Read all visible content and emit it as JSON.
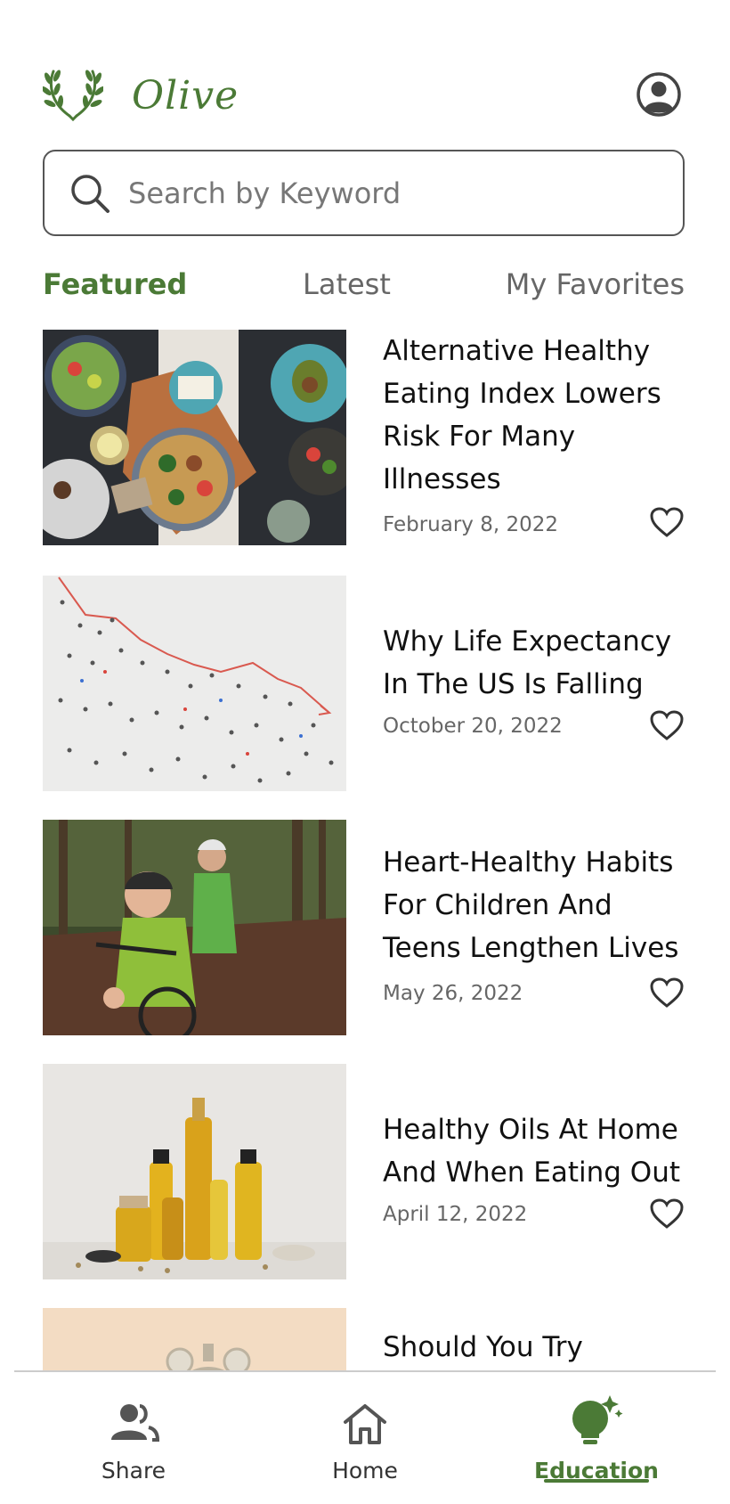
{
  "app": {
    "name": "Olive",
    "accent_color": "#4b7a36",
    "logo_icon": "laurel-wreath-icon",
    "profile_icon": "user-circle-icon"
  },
  "search": {
    "placeholder": "Search by Keyword",
    "value": "",
    "icon": "search-icon"
  },
  "tabs": [
    {
      "label": "Featured",
      "active": true
    },
    {
      "label": "Latest",
      "active": false
    },
    {
      "label": "My Favorites",
      "active": false
    }
  ],
  "articles": [
    {
      "title": "Alternative Healthy Eating Index Lowers Risk For Many Illnesses",
      "date": "February 8, 2022",
      "image": "healthy-food-bowls-image",
      "favorite": false
    },
    {
      "title": "Why Life Expectancy In The US Is Falling",
      "date": "October 20, 2022",
      "image": "people-declining-graph-image",
      "favorite": false
    },
    {
      "title": "Heart-Healthy Habits For Children And Teens Lengthen Lives",
      "date": "May 26, 2022",
      "image": "child-cycling-forest-image",
      "favorite": false
    },
    {
      "title": "Healthy Oils At Home And When Eating Out",
      "date": "April 12, 2022",
      "image": "olive-oil-bottles-image",
      "favorite": false
    },
    {
      "title": "Should You Try",
      "date": "",
      "image": "alarm-clock-image",
      "favorite": false
    }
  ],
  "bottom_nav": [
    {
      "label": "Share",
      "icon": "people-icon",
      "active": false
    },
    {
      "label": "Home",
      "icon": "home-icon",
      "active": false
    },
    {
      "label": "Education",
      "icon": "lightbulb-sparkle-icon",
      "active": true
    }
  ]
}
